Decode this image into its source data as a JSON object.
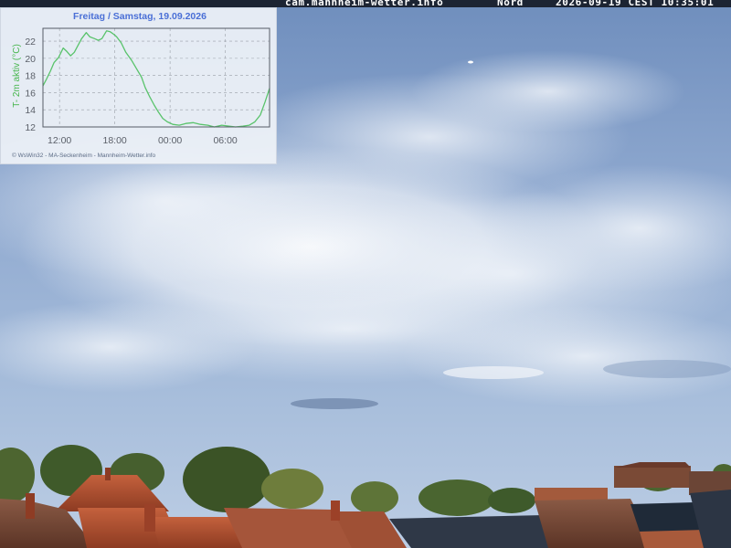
{
  "overlay": {
    "site": "cam.mannheim-wetter.info",
    "direction": "Nord",
    "timestamp": "2026-09-19 CEST 10:35:01"
  },
  "chart_data": {
    "type": "line",
    "title": "Freitag / Samstag, 19.09.2026",
    "ylabel": "T- 2m aktiv (°C)",
    "ylim": [
      12,
      23.5
    ],
    "yticks": [
      12,
      14,
      16,
      18,
      20,
      22
    ],
    "xlim": [
      10.2,
      34.8
    ],
    "xticks": [
      {
        "value": 12,
        "label": "12:00"
      },
      {
        "value": 18,
        "label": "18:00"
      },
      {
        "value": 24,
        "label": "00:00"
      },
      {
        "value": 30,
        "label": "06:00"
      }
    ],
    "grid": true,
    "color": "#59c36b",
    "footer": "© WsWin32 - MA-Seckenheim - Mannheim-Wetter.info",
    "series": [
      {
        "x": [
          10.2,
          10.6,
          11.0,
          11.4,
          11.9,
          12.4,
          12.8,
          13.2,
          13.6,
          14.0,
          14.4,
          14.9,
          15.3,
          15.8,
          16.2,
          16.6,
          17.1,
          17.5,
          17.9,
          18.2,
          18.7,
          19.2,
          19.8,
          20.3,
          20.9,
          21.3,
          21.8,
          22.3,
          22.7,
          23.2,
          23.7,
          24.3,
          25.0,
          25.7,
          26.5,
          27.3,
          28.1,
          28.8,
          29.6,
          30.4,
          31.1,
          31.9,
          32.6,
          33.2,
          33.8,
          34.3,
          34.8
        ],
        "y": [
          16.8,
          17.6,
          18.5,
          19.5,
          20.1,
          21.2,
          20.8,
          20.3,
          20.7,
          21.5,
          22.3,
          23.0,
          22.5,
          22.3,
          22.1,
          22.3,
          23.2,
          23.1,
          22.8,
          22.5,
          21.8,
          20.7,
          19.8,
          18.9,
          17.8,
          16.6,
          15.5,
          14.5,
          13.8,
          13.0,
          12.6,
          12.3,
          12.2,
          12.4,
          12.5,
          12.3,
          12.2,
          12.0,
          12.2,
          12.1,
          12.0,
          12.1,
          12.2,
          12.6,
          13.4,
          14.9,
          16.5
        ]
      }
    ]
  }
}
